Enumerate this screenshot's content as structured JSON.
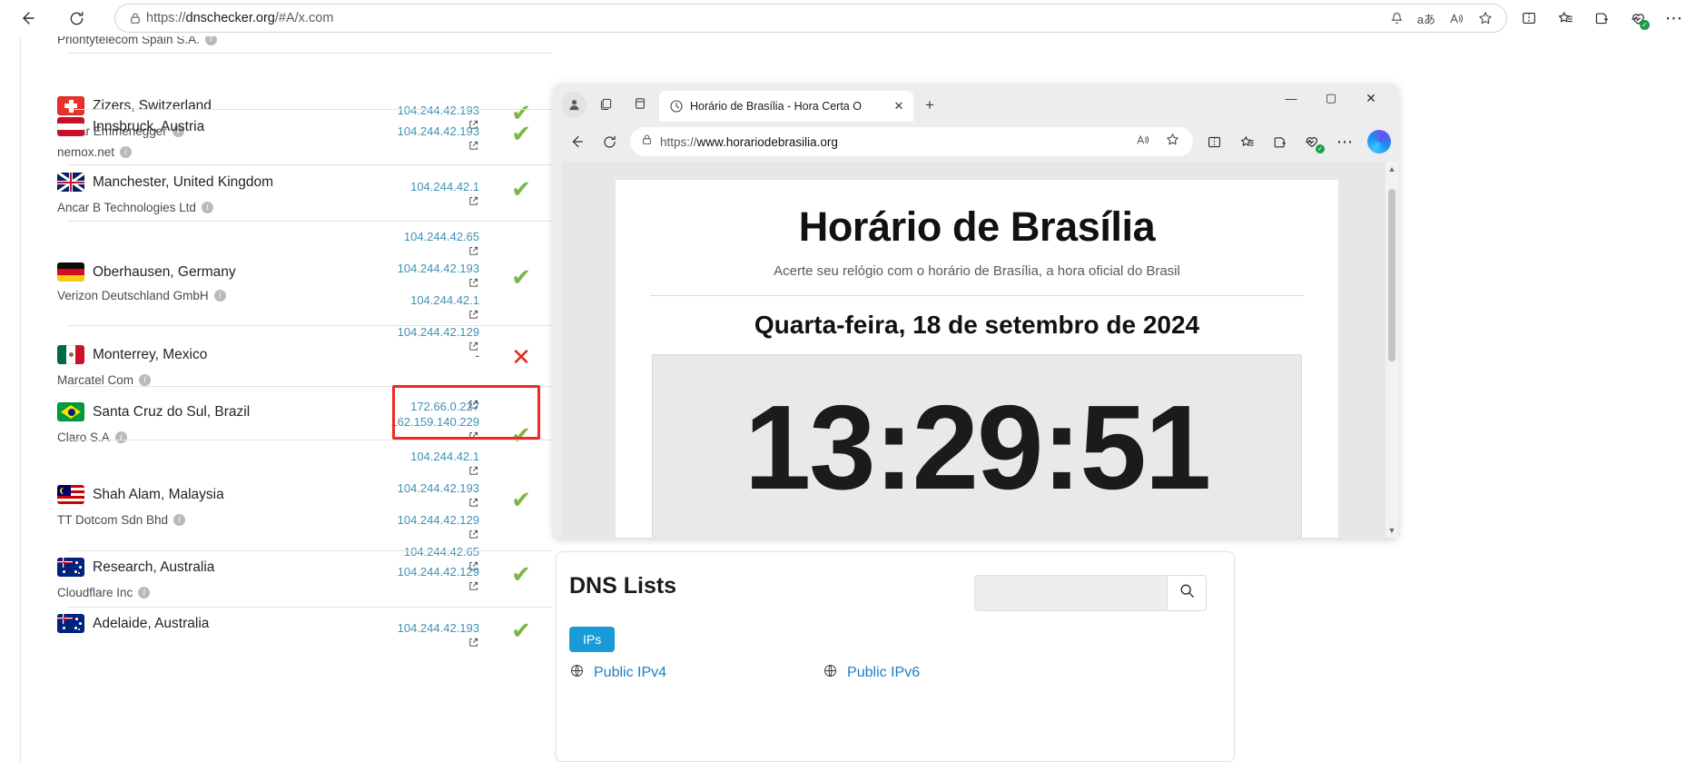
{
  "outer_browser": {
    "url_prefix": "https://",
    "url_main": "dnschecker.org",
    "url_suffix": "/#A/x.com",
    "icons": {
      "back": "back-arrow-icon",
      "reload": "reload-icon",
      "lock": "lock-icon",
      "notifications": "bell-icon",
      "translate": "translate-icon",
      "read_aloud": "read-aloud-icon",
      "favorite": "star-icon",
      "split_screen": "split-screen-icon",
      "favorites_list": "favorites-icon",
      "collections": "collections-icon",
      "browser_essentials": "browser-essentials-icon",
      "settings_more": "more-options-icon"
    }
  },
  "dns_results": {
    "partial_top_isp": "Priontytelecom Spain S.A.",
    "rows": [
      {
        "location": "Zizers, Switzerland",
        "isp": "Oskar Emmenegger",
        "flag": "ch",
        "ips": [
          "104.244.42.193"
        ],
        "status": "ok"
      },
      {
        "location": "Innsbruck, Austria",
        "isp": "nemox.net",
        "flag": "at",
        "ips": [
          "104.244.42.193"
        ],
        "status": "ok"
      },
      {
        "location": "Manchester, United Kingdom",
        "isp": "Ancar B Technologies Ltd",
        "flag": "gb",
        "ips": [
          "104.244.42.1"
        ],
        "status": "ok"
      },
      {
        "location": "Oberhausen, Germany",
        "isp": "Verizon Deutschland GmbH",
        "flag": "de",
        "ips": [
          "104.244.42.65",
          "104.244.42.193",
          "104.244.42.1",
          "104.244.42.129"
        ],
        "status": "ok"
      },
      {
        "location": "Monterrey, Mexico",
        "isp": "Marcatel Com",
        "flag": "mx",
        "ips": [
          "-"
        ],
        "status": "fail"
      },
      {
        "location": "Santa Cruz do Sul, Brazil",
        "isp": "Claro S.A",
        "flag": "br",
        "ips": [
          "172.66.0.227",
          "162.159.140.229"
        ],
        "status": "ok",
        "highlighted": true
      },
      {
        "location": "Shah Alam, Malaysia",
        "isp": "TT Dotcom Sdn Bhd",
        "flag": "my",
        "ips": [
          "104.244.42.1",
          "104.244.42.193",
          "104.244.42.129",
          "104.244.42.65"
        ],
        "status": "ok"
      },
      {
        "location": "Research, Australia",
        "isp": "Cloudflare Inc",
        "flag": "au",
        "ips": [
          "104.244.42.129"
        ],
        "status": "ok"
      },
      {
        "location": "Adelaide, Australia",
        "isp": "",
        "flag": "au",
        "ips": [
          "104.244.42.193"
        ],
        "status": "ok"
      }
    ],
    "status_glyphs": {
      "ok": "✔",
      "fail": "✕"
    },
    "colors": {
      "ok": "#7ab648",
      "fail": "#e02b20",
      "ip_link": "#3f92b5",
      "highlight": "#ee2a22"
    }
  },
  "inner_browser": {
    "tab_title": "Horário de Brasília - Hora Certa O",
    "tab_close_glyph": "✕",
    "new_tab_glyph": "+",
    "url_prefix": "https://",
    "url_main": "www.horariodebrasilia.org",
    "window_buttons": {
      "minimize": "—",
      "maximize": "▢",
      "close": "✕"
    },
    "icons": {
      "profile": "profile-icon",
      "tab_copy": "workspaces-icon",
      "tab_vertical": "vertical-tabs-icon",
      "favicon": "clock-favicon",
      "back": "back-arrow-icon",
      "reload": "reload-icon",
      "lock": "lock-icon",
      "read_aloud": "read-aloud-icon",
      "favorite": "star-icon",
      "split_screen": "split-screen-icon",
      "favorites_list": "favorites-icon",
      "collections": "collections-icon",
      "browser_essentials": "browser-essentials-icon",
      "more": "more-options-icon",
      "copilot": "copilot-icon"
    },
    "page": {
      "title": "Horário de Brasília",
      "subtitle": "Acerte seu relógio com o horário de Brasília, a hora oficial do Brasil",
      "date": "Quarta-feira, 18 de setembro de 2024",
      "clock": "13:29:51"
    },
    "scrollbar": {
      "up": "▲",
      "down": "▼"
    }
  },
  "dns_lists_card": {
    "title": "DNS Lists",
    "search_placeholder": "",
    "search_value": "",
    "search_icon": "search-icon",
    "tab_label": "IPs",
    "links": [
      {
        "label": "Public IPv4",
        "icon": "globe-icon"
      },
      {
        "label": "Public IPv6",
        "icon": "globe-icon"
      }
    ],
    "accent": "#1a9ad7"
  }
}
